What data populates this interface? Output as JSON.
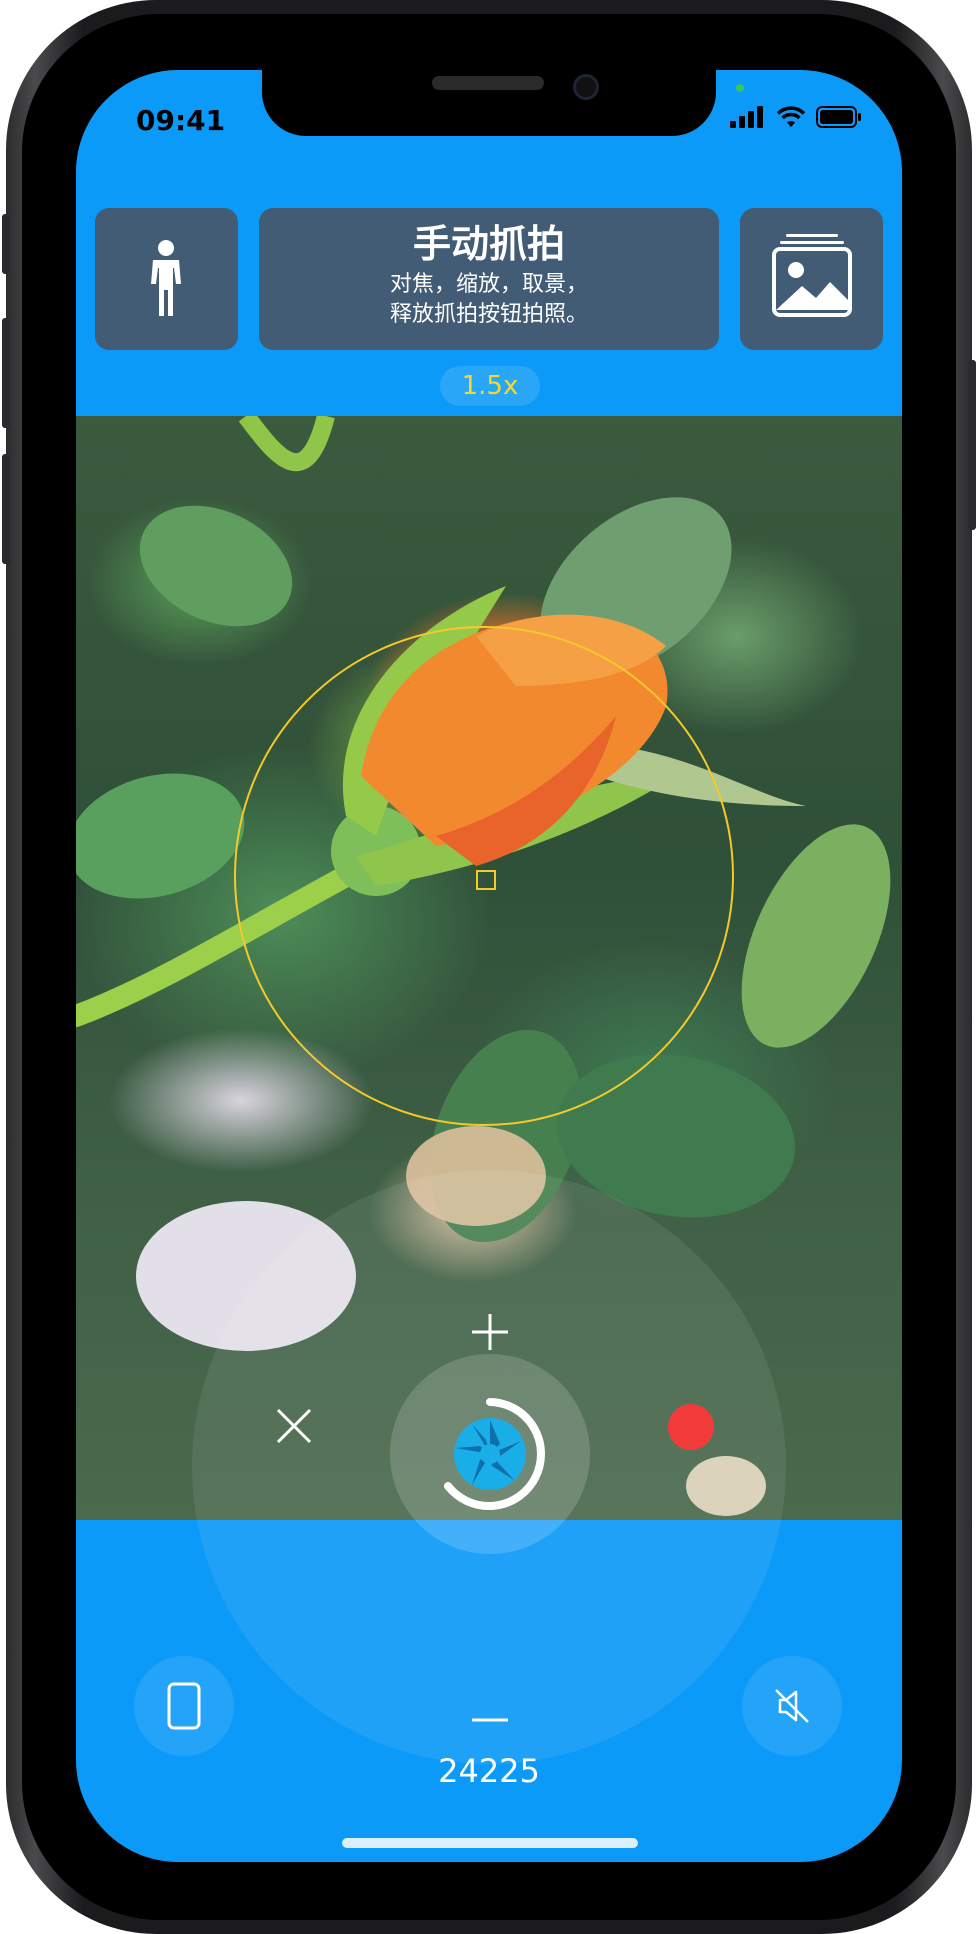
{
  "status_bar": {
    "time": "09:41"
  },
  "toolbar": {
    "mode_title": "手动抓拍",
    "mode_desc_line1": "对焦，缩放，取景，",
    "mode_desc_line2": "释放抓拍按钮拍照。"
  },
  "zoom": {
    "level": "1.5x"
  },
  "capture": {
    "count": "24225"
  },
  "icons": {
    "person": "person-icon",
    "gallery": "gallery-icon",
    "plus": "zoom-in-icon",
    "minus": "zoom-out-icon",
    "close": "close-icon",
    "shutter": "aperture-icon",
    "record": "record-dot",
    "orientation": "phone-portrait-icon",
    "mute": "mute-icon"
  },
  "colors": {
    "accent_blue": "#0c9af8",
    "tile": "#435c75",
    "focus_yellow": "#f4c92a",
    "record_red": "#f23b3b",
    "zoom_text": "#f7d92a"
  }
}
